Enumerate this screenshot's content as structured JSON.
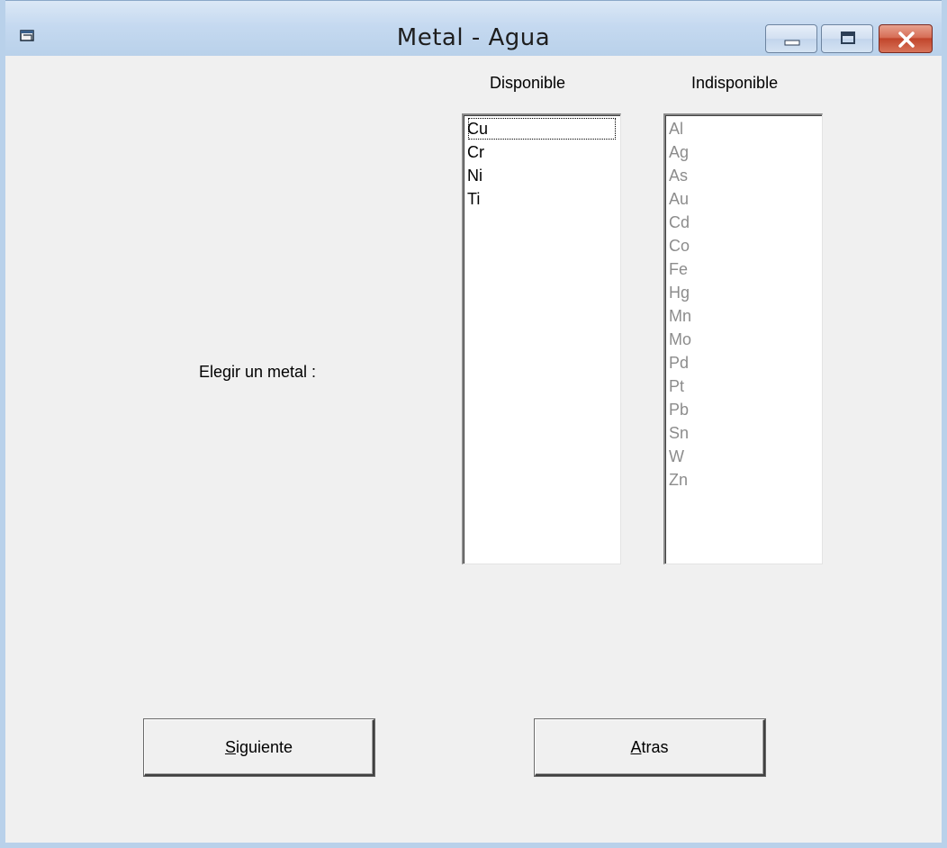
{
  "window": {
    "title": "Metal - Agua",
    "icons": [
      "app-icon",
      "minimize-icon",
      "maximize-icon",
      "close-icon"
    ]
  },
  "labels": {
    "available": "Disponible",
    "unavailable": "Indisponible",
    "prompt": "Elegir un metal :"
  },
  "available_list": {
    "items": [
      "Cu",
      "Cr",
      "Ni",
      "Ti"
    ],
    "focused": "Cu"
  },
  "unavailable_list": {
    "items": [
      "Al",
      "Ag",
      "As",
      "Au",
      "Cd",
      "Co",
      "Fe",
      "Hg",
      "Mn",
      "Mo",
      "Pd",
      "Pt",
      "Pb",
      "Sn",
      "W",
      "Zn"
    ]
  },
  "buttons": {
    "next": {
      "mnemonic": "S",
      "rest": "iguiente"
    },
    "back": {
      "mnemonic": "A",
      "rest": "tras"
    }
  },
  "colors": {
    "frame": "#b9d1ea",
    "client": "#f0f0f0",
    "disabled_text": "#8c8c8c",
    "close_button": "#c1452b"
  }
}
